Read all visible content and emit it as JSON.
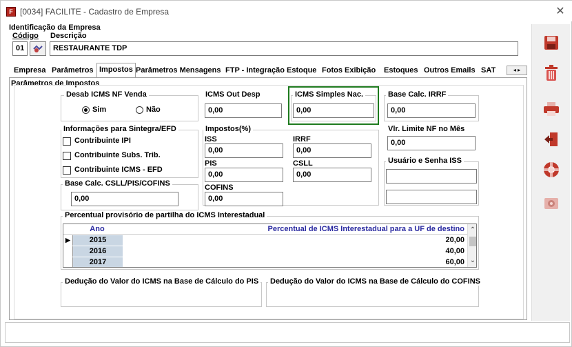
{
  "window": {
    "title": "[0034] FACILITE - Cadastro de Empresa",
    "close_glyph": "✕"
  },
  "identification": {
    "section_label": "Identificação da Empresa",
    "code_label": "Código",
    "description_label": "Descrição",
    "code_value": "01",
    "description_value": "RESTAURANTE TDP"
  },
  "tabs": [
    {
      "label": "Empresa"
    },
    {
      "label": "Parâmetros"
    },
    {
      "label": "Impostos"
    },
    {
      "label": "Parâmetros Mensagens"
    },
    {
      "label": "FTP - Integração Estoque"
    },
    {
      "label": "Fotos Exibição"
    },
    {
      "label": "Estoques"
    },
    {
      "label": "Outros Emails"
    },
    {
      "label": "SAT"
    }
  ],
  "tab_arrows": "◂ ▸",
  "panel": {
    "title": "Parâmetros de Impostos",
    "desab_icms": {
      "title": "Desab ICMS NF Venda",
      "option_sim": "Sim",
      "option_nao": "Não",
      "selected": "Sim"
    },
    "icms_out_desp": {
      "label": "ICMS Out Desp",
      "value": "0,00"
    },
    "icms_simples": {
      "label": "ICMS Simples Nac.",
      "value": "0,00"
    },
    "base_calc_irrf": {
      "label": "Base Calc. IRRF",
      "value": "0,00"
    },
    "sintegra": {
      "title": "Informações para Sintegra/EFD",
      "items": [
        "Contribuinte IPI",
        "Contribuinte Subs. Trib.",
        "Contribuinte ICMS - EFD"
      ]
    },
    "impostos": {
      "title": "Impostos(%)",
      "iss": {
        "label": "ISS",
        "value": "0,00"
      },
      "irrf": {
        "label": "IRRF",
        "value": "0,00"
      },
      "pis": {
        "label": "PIS",
        "value": "0,00"
      },
      "csll": {
        "label": "CSLL",
        "value": "0,00"
      },
      "cofins": {
        "label": "COFINS",
        "value": "0,00"
      }
    },
    "vlr_limite": {
      "label": "Vlr. Limite NF no Mês",
      "value": "0,00"
    },
    "usuario_senha_iss": {
      "label": "Usuário e Senha ISS",
      "user": "",
      "password": ""
    },
    "base_calc_csll": {
      "label": "Base Calc. CSLL/PIS/COFINS",
      "value": "0,00"
    },
    "partilha": {
      "title": "Percentual provisório de partilha do ICMS Interestadual",
      "col_ano": "Ano",
      "col_percentual": "Percentual de ICMS Interestadual para a UF de destino",
      "rows": [
        {
          "ano": "2015",
          "percentual": "20,00"
        },
        {
          "ano": "2016",
          "percentual": "40,00"
        },
        {
          "ano": "2017",
          "percentual": "60,00"
        }
      ]
    },
    "deducao_pis": {
      "title": "Dedução do Valor do ICMS na Base de Cálculo do PIS"
    },
    "deducao_cofins": {
      "title": "Dedução do Valor do ICMS na Base de Cálculo do COFINS"
    }
  },
  "colors": {
    "highlight": "#1e7a1e",
    "grid_header": "#2a2aa0",
    "title_icon": "#b3261e"
  },
  "toolbar_icons": [
    "save-icon",
    "delete-icon",
    "print-icon",
    "exit-icon",
    "help-icon",
    "settings-icon"
  ]
}
